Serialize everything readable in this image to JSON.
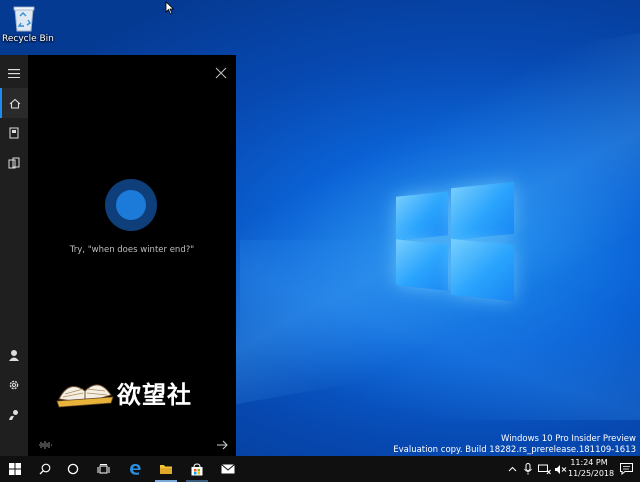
{
  "desktop": {
    "recycle_bin_label": "Recycle Bin"
  },
  "cortana": {
    "hint_text": "Try, \"when does winter end?\"",
    "watermark_text": "欲望社",
    "accent_color": "#1c7ad8",
    "rail_icons": [
      "menu-icon",
      "home-icon",
      "notebook-icon",
      "devices-icon",
      "account-icon",
      "settings-icon",
      "feedback-icon"
    ]
  },
  "system_watermark": {
    "line1": "Windows 10 Pro Insider Preview",
    "line2": "Evaluation copy. Build 18282.rs_prerelease.181109-1613"
  },
  "taskbar": {
    "apps": [
      "start-icon",
      "search-icon",
      "cortana-icon",
      "task-view-icon",
      "edge-icon",
      "file-explorer-icon",
      "store-icon",
      "mail-icon"
    ],
    "clock_time": "11:24 PM",
    "clock_date": "11/25/2018"
  }
}
